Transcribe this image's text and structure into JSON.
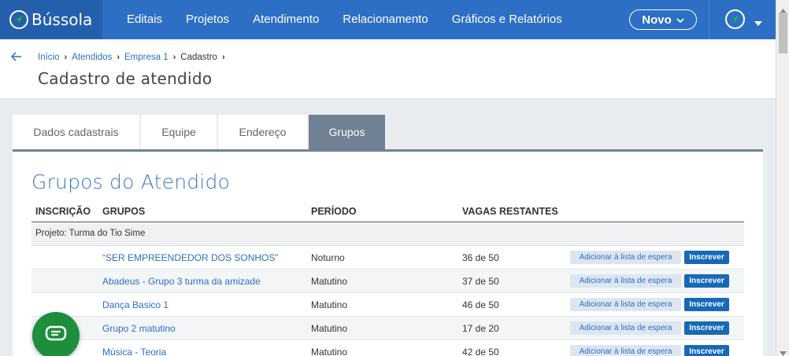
{
  "brand": {
    "name": "Bússola"
  },
  "nav": {
    "items": [
      "Editais",
      "Projetos",
      "Atendimento",
      "Relacionamento",
      "Gráficos e Relatórios"
    ],
    "new_label": "Novo"
  },
  "breadcrumb": {
    "items": [
      "Início",
      "Atendidos",
      "Empresa 1"
    ],
    "current": "Cadastro"
  },
  "page": {
    "title": "Cadastro de atendido"
  },
  "tabs": [
    "Dados cadastrais",
    "Equipe",
    "Endereço",
    "Grupos"
  ],
  "active_tab": "Grupos",
  "section": {
    "title": "Grupos do Atendido"
  },
  "table": {
    "headers": [
      "INSCRIÇÃO",
      "GRUPOS",
      "PERÍODO",
      "VAGAS RESTANTES"
    ],
    "project_label": "Projeto: Turma do Tio Sime",
    "rows": [
      {
        "group": "“SER EMPREENDEDOR DOS SONHOS”",
        "period": "Noturno",
        "vagas": "36 de 50"
      },
      {
        "group": "Abadeus - Grupo 3 turma da amizade",
        "period": "Matutino",
        "vagas": "37 de 50"
      },
      {
        "group": "Dança Basico 1",
        "period": "Matutino",
        "vagas": "46 de 50"
      },
      {
        "group": "Grupo 2 matutino",
        "period": "Matutino",
        "vagas": "17 de 20"
      },
      {
        "group": "Música - Teoria",
        "period": "Matutino",
        "vagas": "42 de 50"
      }
    ],
    "wait_label": "Adicionar à lista de espera",
    "subscribe_label": "Inscrever"
  },
  "colors": {
    "nav_bg": "#2d6fc4",
    "brand_bg": "#245fad",
    "accent": "#2d6fc4",
    "tab_active": "#708194",
    "primary_button": "#1769b8",
    "chat_fab": "#1c8e3c"
  },
  "icons": [
    "compass-logo-icon",
    "chevron-down-icon",
    "back-arrow-icon",
    "chat-icon"
  ]
}
